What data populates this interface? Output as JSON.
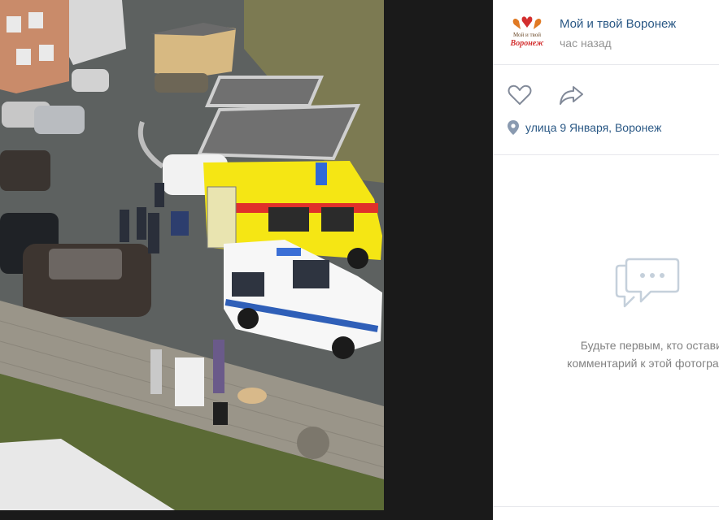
{
  "post": {
    "author": "Мой и твой Воронеж",
    "time": "час назад",
    "logo": {
      "text_top": "Мой и твой",
      "text_bottom": "Воронеж",
      "accent": "#d32f2f"
    }
  },
  "actions": {
    "like_icon": "heart-icon",
    "share_icon": "share-arrow-icon"
  },
  "location": {
    "icon": "map-pin-icon",
    "text": "улица 9 Января, Воронеж"
  },
  "comments": {
    "icon": "comment-bubble-icon",
    "empty_line1": "Будьте первым, кто оставит",
    "empty_line2": "комментарий к этой фотографии"
  },
  "colors": {
    "link": "#2a5885",
    "muted": "#939393",
    "ambulance": "#f5e614",
    "police": "#ffffff"
  }
}
